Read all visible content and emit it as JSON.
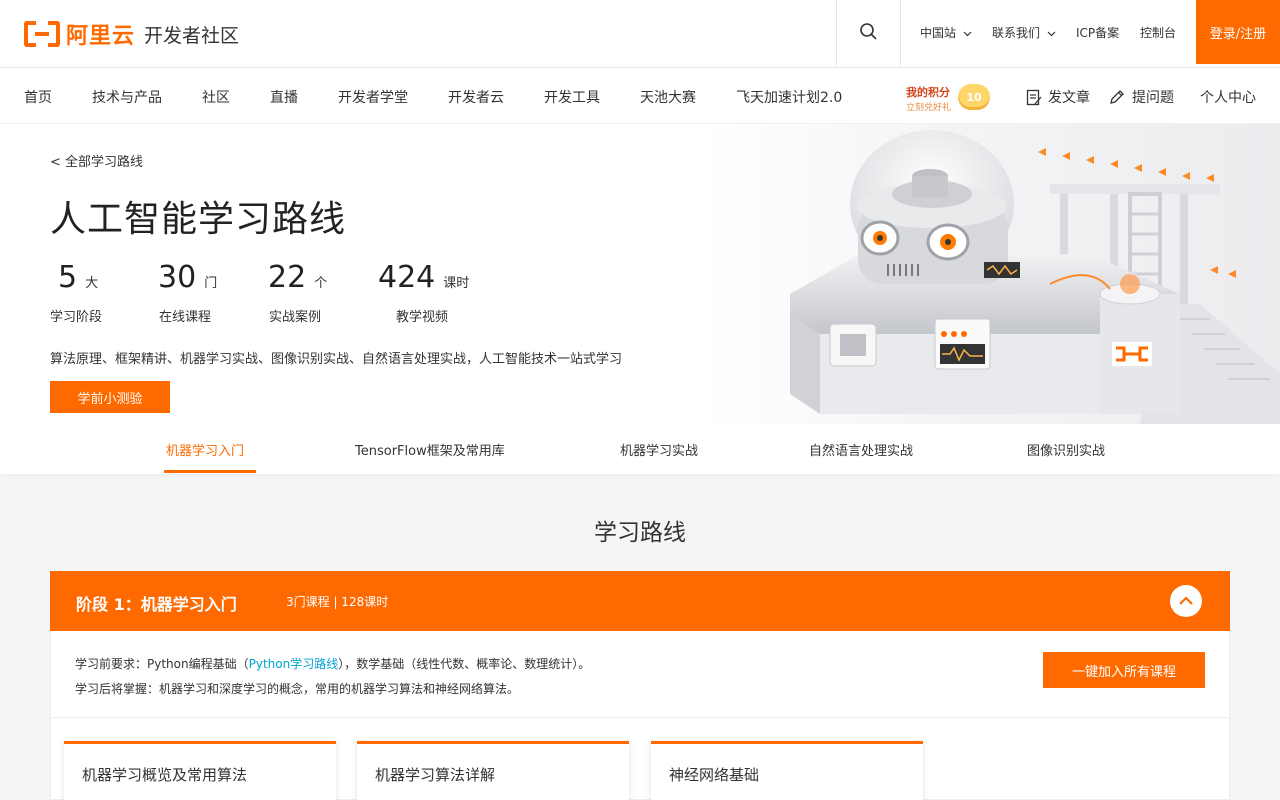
{
  "header": {
    "logo_text": "阿里云",
    "site_title": "开发者社区",
    "links": [
      "中国站",
      "联系我们",
      "ICP备案",
      "控制台"
    ],
    "login": "登录/注册"
  },
  "nav": {
    "items": [
      "首页",
      "技术与产品",
      "社区",
      "直播",
      "开发者学堂",
      "开发者云",
      "开发工具",
      "天池大赛",
      "飞天加速计划2.0"
    ],
    "points_title": "我的积分",
    "points_sub": "立刻兑好礼",
    "points_value": "10",
    "write_article": "发文章",
    "ask_question": "提问题",
    "personal_center": "个人中心"
  },
  "hero": {
    "back": "< 全部学习路线",
    "title": "人工智能学习路线",
    "stats": [
      {
        "num": "5",
        "unit": "大",
        "label": "学习阶段"
      },
      {
        "num": "30",
        "unit": "门",
        "label": "在线课程"
      },
      {
        "num": "22",
        "unit": "个",
        "label": "实战案例"
      },
      {
        "num": "424",
        "unit": "课时",
        "label": "教学视频"
      }
    ],
    "desc": "算法原理、框架精讲、机器学习实战、图像识别实战、自然语言处理实战，人工智能技术一站式学习",
    "quiz": "学前小测验"
  },
  "tabs": [
    "机器学习入门",
    "TensorFlow框架及常用库",
    "机器学习实战",
    "自然语言处理实战",
    "图像识别实战"
  ],
  "section_title": "学习路线",
  "stage": {
    "name": "阶段 1：机器学习入门",
    "meta": "3门课程 | 128课时",
    "req_prefix": "学习前要求：Python编程基础（",
    "req_link": "Python学习路线",
    "req_suffix": "），数学基础（线性代数、概率论、数理统计）。",
    "outcome": "学习后将掌握：机器学习和深度学习的概念，常用的机器学习算法和神经网络算法。",
    "join": "一键加入所有课程",
    "courses": [
      "机器学习概览及常用算法",
      "机器学习算法详解",
      "神经网络基础"
    ]
  },
  "colors": {
    "accent": "#ff6a00",
    "link": "#00a2d4"
  }
}
